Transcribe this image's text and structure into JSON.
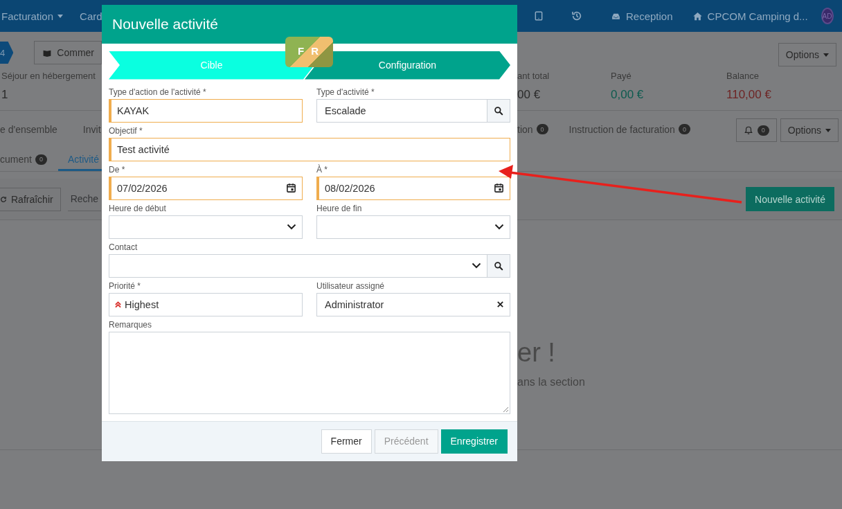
{
  "navbar": {
    "menus": [
      {
        "label": "Facturation",
        "dropdown": true
      },
      {
        "label": "Card",
        "dropdown": false
      }
    ],
    "links": [
      {
        "kind": "tablet"
      },
      {
        "kind": "history"
      },
      {
        "kind": "inbox",
        "label": "Reception"
      },
      {
        "kind": "home",
        "label": "CPCOM Camping d..."
      }
    ],
    "avatar": "AD"
  },
  "header": {
    "step": "4",
    "comment_button": "Commer",
    "options_button": "Options"
  },
  "summary": [
    {
      "label": "Séjour en hébergement",
      "value": "1",
      "color": "#2a2a2a"
    },
    {
      "label": "ant total",
      "value": "00 €",
      "color": "#2a2a2a"
    },
    {
      "label": "Payé",
      "value": "0,00 €",
      "color": "#0d5b4f"
    },
    {
      "label": "Balance",
      "value": "110,00 €",
      "color": "#6e2424"
    }
  ],
  "tabs_top": [
    {
      "label": "e d'ensemble"
    },
    {
      "label": "Invit"
    },
    {
      "label": "tion",
      "count": "0"
    },
    {
      "label": "Instruction de facturation",
      "count": "0"
    }
  ],
  "notifications": {
    "count": "0"
  },
  "options_button": "Options",
  "tabs_bottom": [
    {
      "label": "cument",
      "count": "0",
      "selected": false
    },
    {
      "label": "Activité",
      "selected": true
    }
  ],
  "toolbar": {
    "refresh": "Rafraîchir",
    "search_placeholder": "Reche",
    "new_button": "Nouvelle activité"
  },
  "empty_state": {
    "title": "er !",
    "text": "ans la section"
  },
  "modal": {
    "title": "Nouvelle activité",
    "badge": "F R",
    "steps": [
      {
        "label": "Cible",
        "selected": false
      },
      {
        "label": "Configuration",
        "selected": true
      }
    ],
    "fields": [
      {
        "kind": "text",
        "label": "Type d'action de l'activité *",
        "value": "KAYAK",
        "highlighted": true,
        "wide": false
      },
      {
        "kind": "search",
        "label": "Type d'activité *",
        "value": "Escalade",
        "highlighted": false,
        "wide": false
      },
      {
        "kind": "text",
        "label": "Objectif *",
        "value": "Test activité",
        "highlighted": true,
        "wide": true
      },
      {
        "kind": "date",
        "label": "De *",
        "value": "07/02/2026",
        "highlighted": true,
        "wide": false
      },
      {
        "kind": "date",
        "label": "À *",
        "value": "08/02/2026",
        "highlighted": true,
        "wide": false
      },
      {
        "kind": "select",
        "label": "Heure de début",
        "highlighted": false,
        "wide": false
      },
      {
        "kind": "select",
        "label": "Heure de fin",
        "highlighted": false,
        "wide": false
      },
      {
        "kind": "select-search",
        "label": "Contact",
        "highlighted": false,
        "wide": true
      },
      {
        "kind": "priority",
        "label": "Priorité *",
        "value": "Highest",
        "highlighted": false,
        "wide": false
      },
      {
        "kind": "clearable",
        "label": "Utilisateur assigné",
        "value": "Administrator",
        "highlighted": false,
        "wide": false
      },
      {
        "kind": "textarea",
        "label": "Remarques",
        "highlighted": false,
        "wide": true
      }
    ],
    "buttons": [
      {
        "label": "Fermer",
        "kind": "default",
        "disabled": false
      },
      {
        "label": "Précédent",
        "kind": "default",
        "disabled": true
      },
      {
        "label": "Enregistrer",
        "kind": "primary",
        "disabled": false
      }
    ]
  }
}
